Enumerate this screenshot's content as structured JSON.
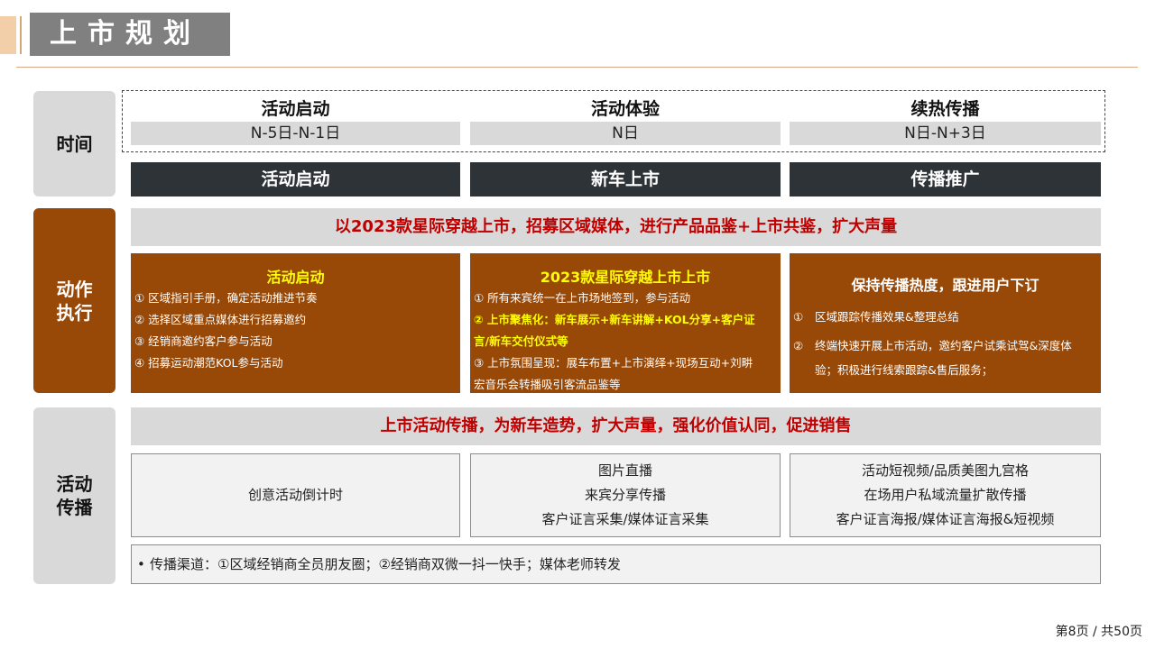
{
  "header": {
    "title": "上市规划"
  },
  "rows": {
    "time_label": "时间",
    "action_label": "动作\n执行",
    "comm_label": "活动\n传播"
  },
  "phases": [
    {
      "name": "活动启动",
      "date": "N-5日-N-1日"
    },
    {
      "name": "活动体验",
      "date": "N日"
    },
    {
      "name": "续热传播",
      "date": "N日-N+3日"
    }
  ],
  "stages": [
    "活动启动",
    "新车上市",
    "传播推广"
  ],
  "action": {
    "banner": "以2023款星际穿越上市，招募区域媒体，进行产品品鉴+上市共鉴，扩大声量",
    "cards": [
      {
        "title": "活动启动",
        "items": [
          "① 区域指引手册，确定活动推进节奏",
          "② 选择区域重点媒体进行招募邀约",
          "③ 经销商邀约客户参与活动",
          "④ 招募运动潮范KOL参与活动"
        ]
      },
      {
        "title": "2023款星际穿越上市上市",
        "items": [
          "① 所有来宾统一在上市场地签到，参与活动",
          "② 上市聚焦化：新车展示+新车讲解+KOL分享+客户证",
          "言/新车交付仪式等",
          "③ 上市氛围呈现：展车布置+上市演绎+现场互动+刘畊",
          "宏音乐会转播吸引客流品鉴等"
        ]
      },
      {
        "title": "保持传播热度，跟进用户下订",
        "items": [
          "①",
          "区域跟踪传播效果&整理总结",
          "②",
          "终端快速开展上市活动，邀约客户试乘试驾&深度体",
          "验；积极进行线索跟踪&售后服务；"
        ]
      }
    ]
  },
  "comm": {
    "banner": "上市活动传播，为新车造势，扩大声量，强化价值认同，促进销售",
    "boxes": [
      [
        "创意活动倒计时"
      ],
      [
        "图片直播",
        "来宾分享传播",
        "客户证言采集/媒体证言采集"
      ],
      [
        "活动短视频/品质美图九宫格",
        "在场用户私域流量扩散传播",
        "客户证言海报/媒体证言海报&短视频"
      ]
    ],
    "channel_bullet": "•",
    "channel": "传播渠道：①区域经销商全员朋友圈；②经销商双微一抖一快手；媒体老师转发"
  },
  "footer": {
    "page": "第8页 / 共50页"
  },
  "colors": {
    "brown": "#984807",
    "dark": "#2e3338",
    "gray": "#d9d9d9",
    "red": "#c00000",
    "yellow": "#ffff00"
  }
}
